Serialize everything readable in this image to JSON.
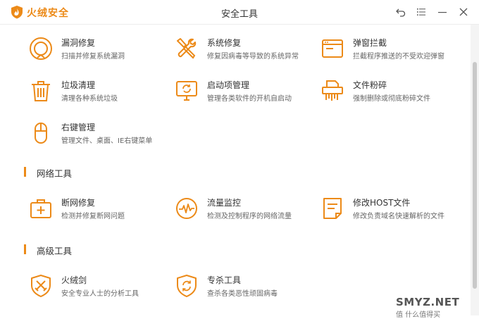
{
  "app": {
    "brand": "火绒安全",
    "window_title": "安全工具"
  },
  "title_buttons": [
    {
      "name": "back-icon"
    },
    {
      "name": "menu-icon"
    },
    {
      "name": "minimize-icon"
    },
    {
      "name": "close-icon"
    }
  ],
  "tools": {
    "vuln_fix": {
      "name": "漏洞修复",
      "desc": "扫描并修复系统漏洞",
      "icon": "vulnerability-icon"
    },
    "sys_fix": {
      "name": "系统修复",
      "desc": "修复因病毒等导致的系统异常",
      "icon": "wrench-screwdriver-icon"
    },
    "popup_block": {
      "name": "弹窗拦截",
      "desc": "拦截程序推送的不受欢迎弹窗",
      "icon": "popup-window-icon"
    },
    "junk_clean": {
      "name": "垃圾清理",
      "desc": "清理各种系统垃圾",
      "icon": "trash-icon"
    },
    "startup_mgr": {
      "name": "启动项管理",
      "desc": "管理各类软件的开机自启动",
      "icon": "monitor-refresh-icon"
    },
    "file_shred": {
      "name": "文件粉碎",
      "desc": "强制删除或彻底粉碎文件",
      "icon": "shredder-icon"
    },
    "context_menu": {
      "name": "右键管理",
      "desc": "管理文件、桌面、IE右键菜单",
      "icon": "mouse-icon"
    },
    "net_fix": {
      "name": "断网修复",
      "desc": "检测并修复断网问题",
      "icon": "medical-kit-icon"
    },
    "traffic_mon": {
      "name": "流量监控",
      "desc": "检测及控制程序的网络流量",
      "icon": "gauge-icon"
    },
    "host_edit": {
      "name": "修改HOST文件",
      "desc": "修改负责域名快速解析的文件",
      "icon": "document-edit-icon"
    },
    "huorong_sword": {
      "name": "火绒剑",
      "desc": "安全专业人士的分析工具",
      "icon": "sword-shield-icon"
    },
    "kill_tool": {
      "name": "专杀工具",
      "desc": "查杀各类恶性顽固病毒",
      "icon": "shield-refresh-icon"
    }
  },
  "sections": {
    "network": "网络工具",
    "advanced": "高级工具"
  },
  "watermark": {
    "site": "SMYZ.NET",
    "sub": "值 什么值得买"
  },
  "colors": {
    "accent": "#ec8a18",
    "text": "#333333",
    "subtext": "#666666"
  }
}
